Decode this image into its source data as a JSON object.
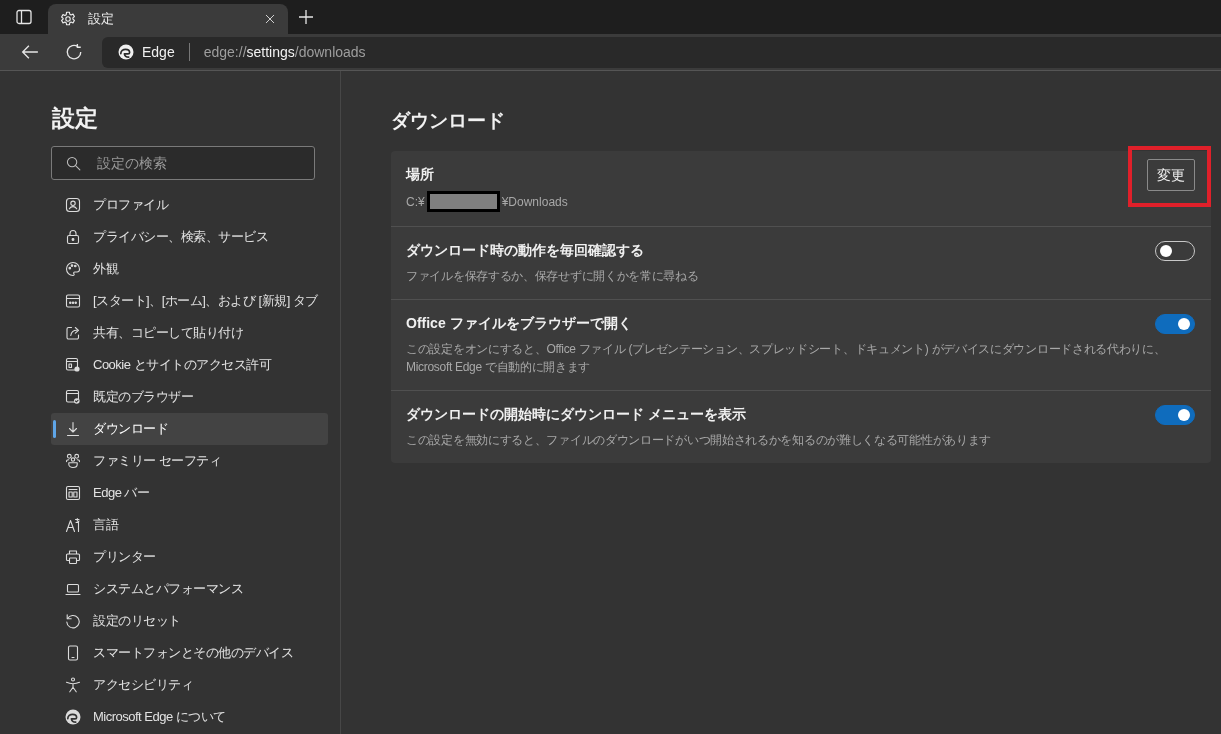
{
  "browser": {
    "tab": {
      "title": "設定",
      "selected": true
    },
    "address_bar": {
      "site_name": "Edge",
      "url_scheme": "edge://",
      "url_host": "settings",
      "url_path": "/downloads"
    }
  },
  "sidebar": {
    "title": "設定",
    "search": {
      "placeholder": "設定の検索"
    },
    "items": [
      {
        "label": "プロファイル",
        "selected": false
      },
      {
        "label": "プライバシー、検索、サービス",
        "selected": false
      },
      {
        "label": "外観",
        "selected": false
      },
      {
        "label": "[スタート]、[ホーム]、および [新規] タブ",
        "selected": false
      },
      {
        "label": "共有、コピーして貼り付け",
        "selected": false
      },
      {
        "label": "Cookie とサイトのアクセス許可",
        "selected": false
      },
      {
        "label": "既定のブラウザー",
        "selected": false
      },
      {
        "label": "ダウンロード",
        "selected": true
      },
      {
        "label": "ファミリー セーフティ",
        "selected": false
      },
      {
        "label": "Edge バー",
        "selected": false
      },
      {
        "label": "言語",
        "selected": false
      },
      {
        "label": "プリンター",
        "selected": false
      },
      {
        "label": "システムとパフォーマンス",
        "selected": false
      },
      {
        "label": "設定のリセット",
        "selected": false
      },
      {
        "label": "スマートフォンとその他のデバイス",
        "selected": false
      },
      {
        "label": "アクセシビリティ",
        "selected": false
      },
      {
        "label": "Microsoft Edge について",
        "selected": false
      }
    ]
  },
  "main": {
    "title": "ダウンロード",
    "settings": [
      {
        "kind": "location",
        "title": "場所",
        "path_start": "C:¥",
        "redacted": true,
        "path_end": "¥Downloads",
        "button": "変更",
        "highlighted": true
      },
      {
        "kind": "toggle",
        "title": "ダウンロード時の動作を毎回確認する",
        "description": "ファイルを保存するか、保存せずに開くかを常に尋ねる",
        "on": false
      },
      {
        "kind": "toggle",
        "title": "Office ファイルをブラウザーで開く",
        "description": "この設定をオンにすると、Office ファイル (プレゼンテーション、スプレッドシート、ドキュメント) がデバイスにダウンロードされる代わりに、Microsoft Edge で自動的に開きます",
        "on": true
      },
      {
        "kind": "toggle",
        "title": "ダウンロードの開始時にダウンロード メニューを表示",
        "description": "この設定を無効にすると、ファイルのダウンロードがいつ開始されるかを知るのが難しくなる可能性があります",
        "on": true
      }
    ]
  }
}
